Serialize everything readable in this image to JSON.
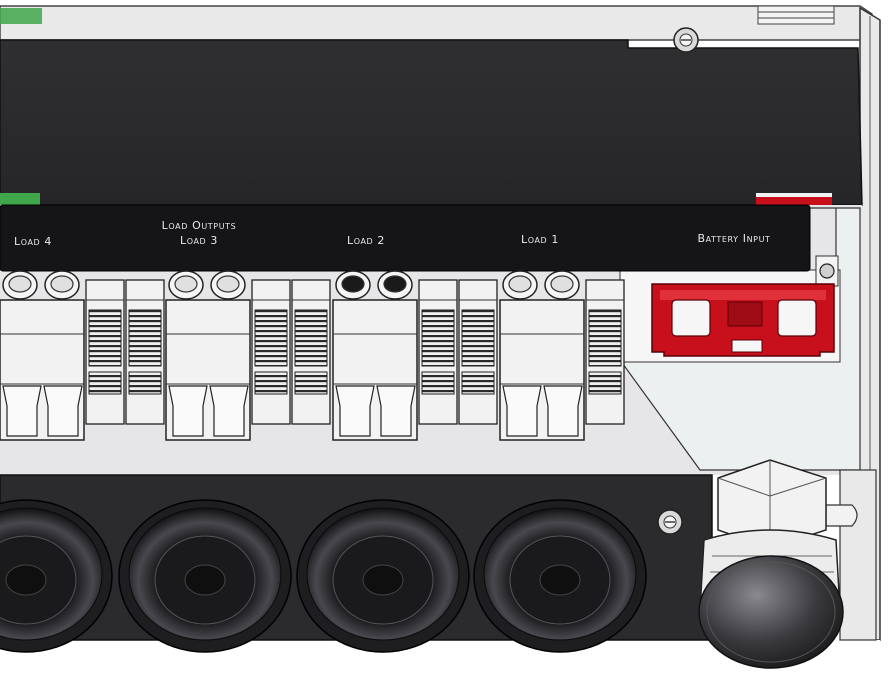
{
  "panel": {
    "group_label": "Load Outputs",
    "labels": {
      "load4": "Load 4",
      "load3": "Load 3",
      "load2": "Load 2",
      "load1": "Load 1",
      "battery": "Battery Input"
    }
  },
  "colors": {
    "housing": "#2b2b2d",
    "label_band": "#151517",
    "terminal": "#f2f2f2",
    "battery_connector": "#c8101c",
    "green_accent": "#3fa64a",
    "red_accent": "#c8101c"
  },
  "icons": [
    "screw-icon",
    "cable-gland-icon",
    "grommet-icon"
  ]
}
